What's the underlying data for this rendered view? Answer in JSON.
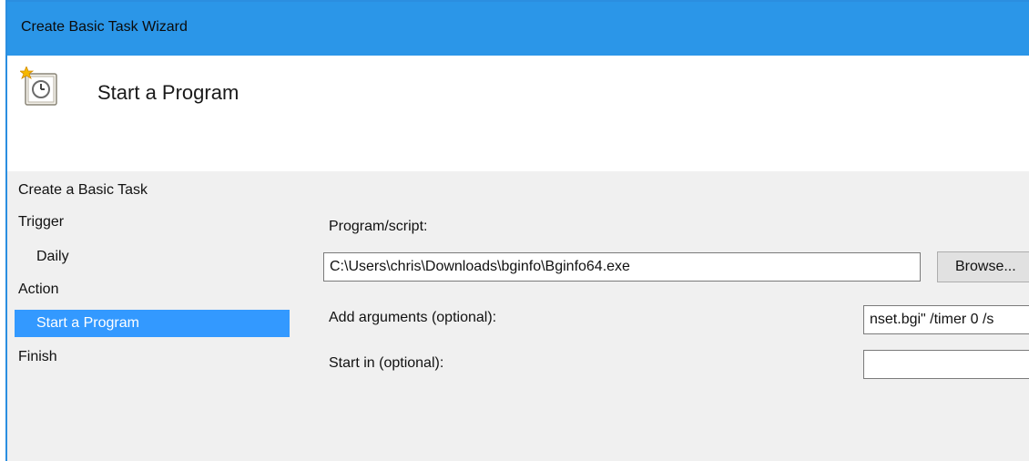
{
  "window": {
    "title": "Create Basic Task Wizard"
  },
  "header": {
    "title": "Start a Program",
    "icon": "task-scheduler-icon"
  },
  "nav": {
    "items": [
      {
        "label": "Create a Basic Task"
      },
      {
        "label": "Trigger"
      },
      {
        "label": "Daily"
      },
      {
        "label": "Action"
      },
      {
        "label": "Start a Program",
        "selected": true
      },
      {
        "label": "Finish"
      }
    ]
  },
  "form": {
    "program_label": "Program/script:",
    "program_value": "C:\\Users\\chris\\Downloads\\bginfo\\Bginfo64.exe",
    "browse_label": "Browse...",
    "arguments_label": "Add arguments (optional):",
    "arguments_value": "nset.bgi\" /timer 0 /s",
    "start_in_label": "Start in (optional):",
    "start_in_value": ""
  },
  "colors": {
    "titlebar": "#2b96e8",
    "selection": "#3399ff",
    "dialog_bg": "#f0f0f0"
  }
}
